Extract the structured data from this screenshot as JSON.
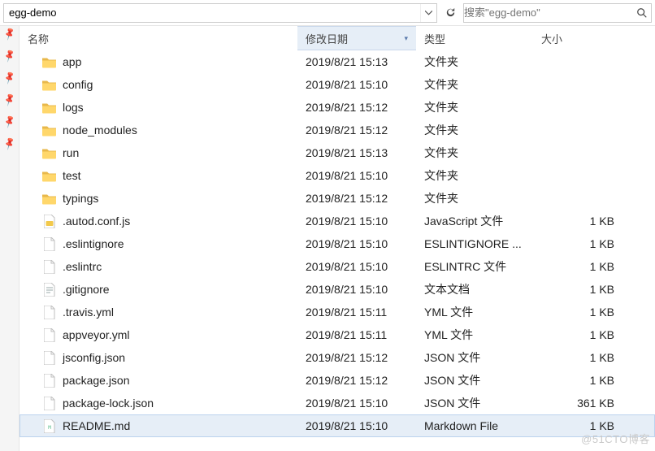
{
  "toolbar": {
    "path_value": "egg-demo",
    "search_placeholder": "搜索\"egg-demo\""
  },
  "columns": {
    "name": "名称",
    "date": "修改日期",
    "type": "类型",
    "size": "大小"
  },
  "rows": [
    {
      "icon": "folder",
      "name": "app",
      "date": "2019/8/21 15:13",
      "type": "文件夹",
      "size": "",
      "selected": false
    },
    {
      "icon": "folder",
      "name": "config",
      "date": "2019/8/21 15:10",
      "type": "文件夹",
      "size": "",
      "selected": false
    },
    {
      "icon": "folder",
      "name": "logs",
      "date": "2019/8/21 15:12",
      "type": "文件夹",
      "size": "",
      "selected": false
    },
    {
      "icon": "folder",
      "name": "node_modules",
      "date": "2019/8/21 15:12",
      "type": "文件夹",
      "size": "",
      "selected": false
    },
    {
      "icon": "folder",
      "name": "run",
      "date": "2019/8/21 15:13",
      "type": "文件夹",
      "size": "",
      "selected": false
    },
    {
      "icon": "folder",
      "name": "test",
      "date": "2019/8/21 15:10",
      "type": "文件夹",
      "size": "",
      "selected": false
    },
    {
      "icon": "folder",
      "name": "typings",
      "date": "2019/8/21 15:12",
      "type": "文件夹",
      "size": "",
      "selected": false
    },
    {
      "icon": "js",
      "name": ".autod.conf.js",
      "date": "2019/8/21 15:10",
      "type": "JavaScript 文件",
      "size": "1 KB",
      "selected": false
    },
    {
      "icon": "file",
      "name": ".eslintignore",
      "date": "2019/8/21 15:10",
      "type": "ESLINTIGNORE ...",
      "size": "1 KB",
      "selected": false
    },
    {
      "icon": "file",
      "name": ".eslintrc",
      "date": "2019/8/21 15:10",
      "type": "ESLINTRC 文件",
      "size": "1 KB",
      "selected": false
    },
    {
      "icon": "txt",
      "name": ".gitignore",
      "date": "2019/8/21 15:10",
      "type": "文本文档",
      "size": "1 KB",
      "selected": false
    },
    {
      "icon": "file",
      "name": ".travis.yml",
      "date": "2019/8/21 15:11",
      "type": "YML 文件",
      "size": "1 KB",
      "selected": false
    },
    {
      "icon": "file",
      "name": "appveyor.yml",
      "date": "2019/8/21 15:11",
      "type": "YML 文件",
      "size": "1 KB",
      "selected": false
    },
    {
      "icon": "file",
      "name": "jsconfig.json",
      "date": "2019/8/21 15:12",
      "type": "JSON 文件",
      "size": "1 KB",
      "selected": false
    },
    {
      "icon": "file",
      "name": "package.json",
      "date": "2019/8/21 15:12",
      "type": "JSON 文件",
      "size": "1 KB",
      "selected": false
    },
    {
      "icon": "file",
      "name": "package-lock.json",
      "date": "2019/8/21 15:10",
      "type": "JSON 文件",
      "size": "361 KB",
      "selected": false
    },
    {
      "icon": "md",
      "name": "README.md",
      "date": "2019/8/21 15:10",
      "type": "Markdown File",
      "size": "1 KB",
      "selected": true
    }
  ],
  "watermark": "@51CTO博客"
}
